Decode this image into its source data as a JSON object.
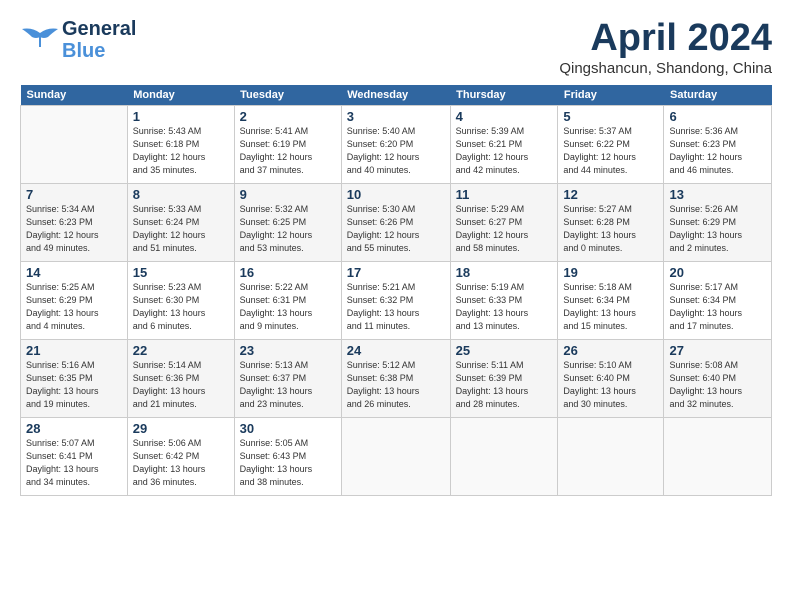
{
  "header": {
    "logo_general": "General",
    "logo_blue": "Blue",
    "title": "April 2024",
    "location": "Qingshancun, Shandong, China"
  },
  "days_of_week": [
    "Sunday",
    "Monday",
    "Tuesday",
    "Wednesday",
    "Thursday",
    "Friday",
    "Saturday"
  ],
  "weeks": [
    [
      {
        "num": "",
        "info": ""
      },
      {
        "num": "1",
        "info": "Sunrise: 5:43 AM\nSunset: 6:18 PM\nDaylight: 12 hours\nand 35 minutes."
      },
      {
        "num": "2",
        "info": "Sunrise: 5:41 AM\nSunset: 6:19 PM\nDaylight: 12 hours\nand 37 minutes."
      },
      {
        "num": "3",
        "info": "Sunrise: 5:40 AM\nSunset: 6:20 PM\nDaylight: 12 hours\nand 40 minutes."
      },
      {
        "num": "4",
        "info": "Sunrise: 5:39 AM\nSunset: 6:21 PM\nDaylight: 12 hours\nand 42 minutes."
      },
      {
        "num": "5",
        "info": "Sunrise: 5:37 AM\nSunset: 6:22 PM\nDaylight: 12 hours\nand 44 minutes."
      },
      {
        "num": "6",
        "info": "Sunrise: 5:36 AM\nSunset: 6:23 PM\nDaylight: 12 hours\nand 46 minutes."
      }
    ],
    [
      {
        "num": "7",
        "info": "Sunrise: 5:34 AM\nSunset: 6:23 PM\nDaylight: 12 hours\nand 49 minutes."
      },
      {
        "num": "8",
        "info": "Sunrise: 5:33 AM\nSunset: 6:24 PM\nDaylight: 12 hours\nand 51 minutes."
      },
      {
        "num": "9",
        "info": "Sunrise: 5:32 AM\nSunset: 6:25 PM\nDaylight: 12 hours\nand 53 minutes."
      },
      {
        "num": "10",
        "info": "Sunrise: 5:30 AM\nSunset: 6:26 PM\nDaylight: 12 hours\nand 55 minutes."
      },
      {
        "num": "11",
        "info": "Sunrise: 5:29 AM\nSunset: 6:27 PM\nDaylight: 12 hours\nand 58 minutes."
      },
      {
        "num": "12",
        "info": "Sunrise: 5:27 AM\nSunset: 6:28 PM\nDaylight: 13 hours\nand 0 minutes."
      },
      {
        "num": "13",
        "info": "Sunrise: 5:26 AM\nSunset: 6:29 PM\nDaylight: 13 hours\nand 2 minutes."
      }
    ],
    [
      {
        "num": "14",
        "info": "Sunrise: 5:25 AM\nSunset: 6:29 PM\nDaylight: 13 hours\nand 4 minutes."
      },
      {
        "num": "15",
        "info": "Sunrise: 5:23 AM\nSunset: 6:30 PM\nDaylight: 13 hours\nand 6 minutes."
      },
      {
        "num": "16",
        "info": "Sunrise: 5:22 AM\nSunset: 6:31 PM\nDaylight: 13 hours\nand 9 minutes."
      },
      {
        "num": "17",
        "info": "Sunrise: 5:21 AM\nSunset: 6:32 PM\nDaylight: 13 hours\nand 11 minutes."
      },
      {
        "num": "18",
        "info": "Sunrise: 5:19 AM\nSunset: 6:33 PM\nDaylight: 13 hours\nand 13 minutes."
      },
      {
        "num": "19",
        "info": "Sunrise: 5:18 AM\nSunset: 6:34 PM\nDaylight: 13 hours\nand 15 minutes."
      },
      {
        "num": "20",
        "info": "Sunrise: 5:17 AM\nSunset: 6:34 PM\nDaylight: 13 hours\nand 17 minutes."
      }
    ],
    [
      {
        "num": "21",
        "info": "Sunrise: 5:16 AM\nSunset: 6:35 PM\nDaylight: 13 hours\nand 19 minutes."
      },
      {
        "num": "22",
        "info": "Sunrise: 5:14 AM\nSunset: 6:36 PM\nDaylight: 13 hours\nand 21 minutes."
      },
      {
        "num": "23",
        "info": "Sunrise: 5:13 AM\nSunset: 6:37 PM\nDaylight: 13 hours\nand 23 minutes."
      },
      {
        "num": "24",
        "info": "Sunrise: 5:12 AM\nSunset: 6:38 PM\nDaylight: 13 hours\nand 26 minutes."
      },
      {
        "num": "25",
        "info": "Sunrise: 5:11 AM\nSunset: 6:39 PM\nDaylight: 13 hours\nand 28 minutes."
      },
      {
        "num": "26",
        "info": "Sunrise: 5:10 AM\nSunset: 6:40 PM\nDaylight: 13 hours\nand 30 minutes."
      },
      {
        "num": "27",
        "info": "Sunrise: 5:08 AM\nSunset: 6:40 PM\nDaylight: 13 hours\nand 32 minutes."
      }
    ],
    [
      {
        "num": "28",
        "info": "Sunrise: 5:07 AM\nSunset: 6:41 PM\nDaylight: 13 hours\nand 34 minutes."
      },
      {
        "num": "29",
        "info": "Sunrise: 5:06 AM\nSunset: 6:42 PM\nDaylight: 13 hours\nand 36 minutes."
      },
      {
        "num": "30",
        "info": "Sunrise: 5:05 AM\nSunset: 6:43 PM\nDaylight: 13 hours\nand 38 minutes."
      },
      {
        "num": "",
        "info": ""
      },
      {
        "num": "",
        "info": ""
      },
      {
        "num": "",
        "info": ""
      },
      {
        "num": "",
        "info": ""
      }
    ]
  ]
}
